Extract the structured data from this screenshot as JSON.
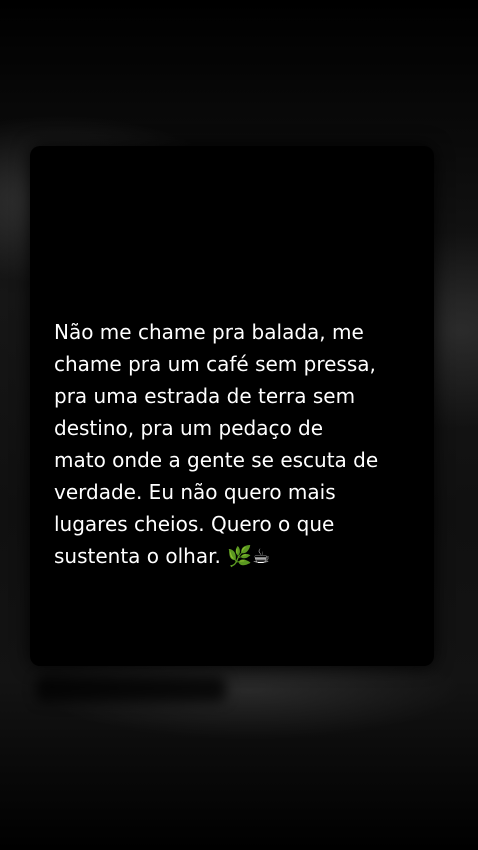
{
  "post": {
    "quote_text": "Não me chame pra balada, me\nchame pra um café sem pressa,\npra uma estrada de terra sem\ndestino, pra um pedaço de\nmato onde a gente se escuta de\nverdade. Eu não quero mais\nlugares cheios. Quero o que\nsustenta o olhar. 🌿☕",
    "text_color": "#ffffff",
    "card_color": "#000000"
  }
}
